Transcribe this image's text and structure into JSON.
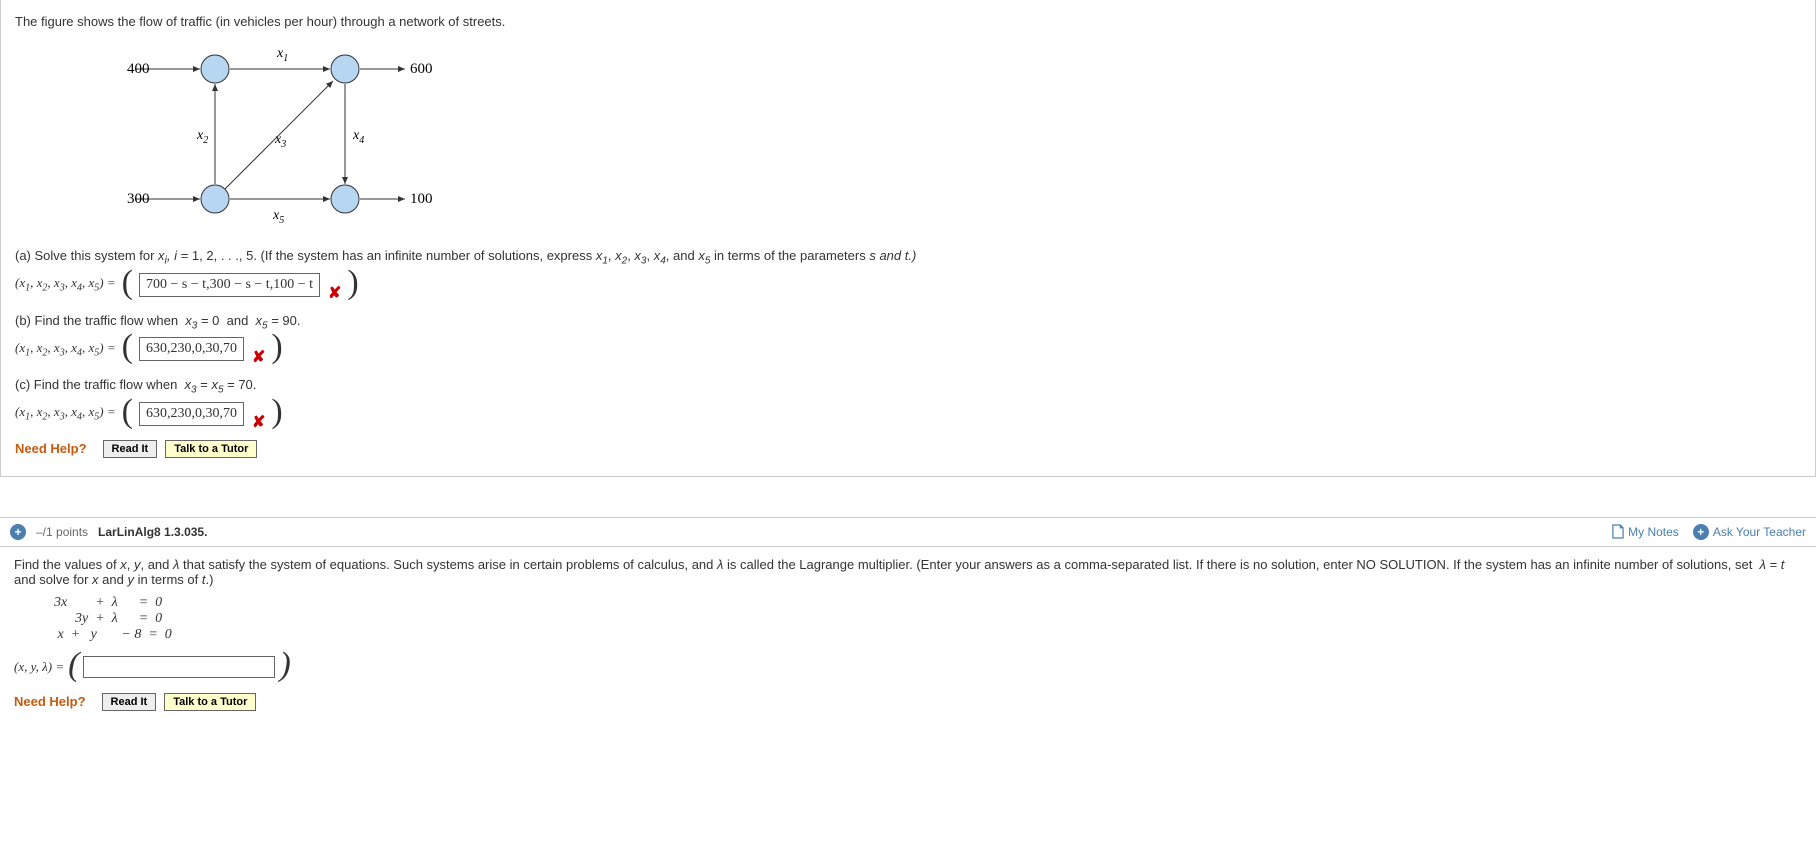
{
  "q1": {
    "intro": "The figure shows the flow of traffic (in vehicles per hour) through a network of streets.",
    "figure": {
      "in_top": "400",
      "out_top": "600",
      "in_bot": "300",
      "out_bot": "100",
      "x1": "x",
      "x1s": "1",
      "x2": "x",
      "x2s": "2",
      "x3": "x",
      "x3s": "3",
      "x4": "x",
      "x4s": "4",
      "x5": "x",
      "x5s": "5"
    },
    "a": {
      "prompt_pre": "(a) Solve this system for ",
      "prompt_mid": " = 1, 2, . . ., 5.  (If the system has an infinite number of solutions, express ",
      "prompt_tail": " in terms of the parameters ",
      "params": "s and t.)",
      "label_pre": "(",
      "label_vars": "x1, x2, x3, x4, x5",
      "label_post": ") = ",
      "value": "700 − s − t,300 − s − t,100 − t"
    },
    "b": {
      "prompt": "(b) Find the traffic flow when  x3 = 0  and  x5 = 90.",
      "value": "630,230,0,30,70"
    },
    "c": {
      "prompt": "(c) Find the traffic flow when  x3 = x5 = 70.",
      "value": "630,230,0,30,70"
    },
    "help": {
      "label": "Need Help?",
      "read": "Read It",
      "tutor": "Talk to a Tutor"
    }
  },
  "q2": {
    "header": {
      "points": "–/1 points",
      "assign": "LarLinAlg8 1.3.035.",
      "mynotes": "My Notes",
      "ask": "Ask Your Teacher"
    },
    "body": "Find the values of x, y, and λ that satisfy the system of equations. Such systems arise in certain problems of calculus, and λ is called the Lagrange multiplier. (Enter your answers as a comma-separated list. If there is no solution, enter NO SOLUTION. If the system has an infinite number of solutions, set  λ = t  and solve for x and y in terms of t.)",
    "eqs": "3x        +  λ      =  0\n      3y  +  λ      =  0\n x  +   y       − 8  =  0",
    "answer_label": "(x, y, λ) = ",
    "answer_value": "",
    "help": {
      "label": "Need Help?",
      "read": "Read It",
      "tutor": "Talk to a Tutor"
    }
  },
  "chart_data": {
    "type": "diagram",
    "description": "Directed traffic-flow network with four nodes (two top, two bottom) and labeled edges.",
    "nodes": [
      {
        "id": "TL",
        "pos": "top-left"
      },
      {
        "id": "TR",
        "pos": "top-right"
      },
      {
        "id": "BL",
        "pos": "bottom-left"
      },
      {
        "id": "BR",
        "pos": "bottom-right"
      }
    ],
    "external_flows": [
      {
        "node": "TL",
        "direction": "in",
        "value": 400
      },
      {
        "node": "TR",
        "direction": "out",
        "value": 600
      },
      {
        "node": "BL",
        "direction": "in",
        "value": 300
      },
      {
        "node": "BR",
        "direction": "out",
        "value": 100
      }
    ],
    "edges": [
      {
        "from": "TL",
        "to": "TR",
        "label": "x1"
      },
      {
        "from": "BL",
        "to": "TL",
        "label": "x2"
      },
      {
        "from": "BL",
        "to": "TR",
        "label": "x3"
      },
      {
        "from": "TR",
        "to": "BR",
        "label": "x4"
      },
      {
        "from": "BL",
        "to": "BR",
        "label": "x5"
      }
    ]
  }
}
